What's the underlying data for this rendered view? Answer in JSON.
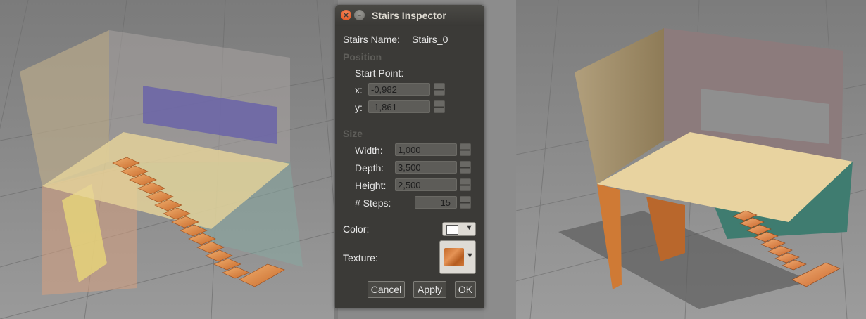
{
  "dialog": {
    "title": "Stairs Inspector",
    "name_label": "Stairs Name:",
    "name_value": "Stairs_0",
    "position_section": "Position",
    "start_point_label": "Start Point:",
    "x_label": "x:",
    "x_value": "-0,982",
    "y_label": "y:",
    "y_value": "-1,861",
    "size_section": "Size",
    "width_label": "Width:",
    "width_value": "1,000",
    "depth_label": "Depth:",
    "depth_value": "3,500",
    "height_label": "Height:",
    "height_value": "2,500",
    "steps_label": "# Steps:",
    "steps_value": "15",
    "color_label": "Color:",
    "color_value": "#ffffff",
    "texture_label": "Texture:",
    "cancel_label": "Cancel",
    "apply_label": "Apply",
    "ok_label": "OK"
  },
  "icons": {
    "close": "close-icon",
    "minimize": "minimize-icon",
    "dropdown": "chevron-down-icon"
  },
  "colors": {
    "dialog_bg": "#3b3a37",
    "viewport_bg": "#8a8a8a",
    "stair_wood": "#e08a45"
  }
}
